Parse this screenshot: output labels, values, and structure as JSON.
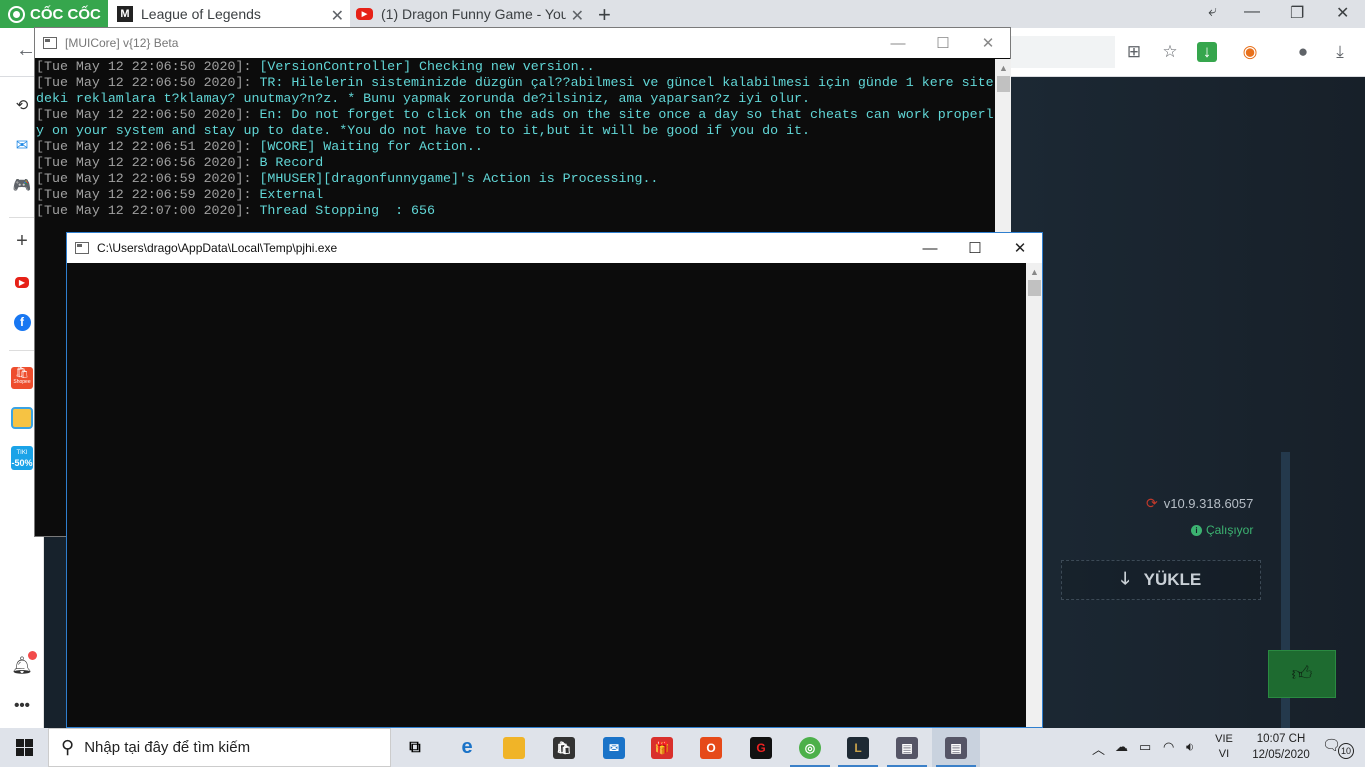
{
  "browser": {
    "logo_text": "CỐC CỐC",
    "tabs": [
      {
        "title": "League of Legends",
        "favicon": "M"
      },
      {
        "title": "(1) Dragon Funny Game - You",
        "favicon": "youtube-icon"
      }
    ],
    "new_tab_symbol": "+",
    "window_controls": [
      "restore-icon",
      "minimize-icon",
      "maximize-icon",
      "close-icon"
    ]
  },
  "sidebar": {
    "items": [
      "history-icon",
      "messenger-icon",
      "game-icon",
      "add-icon",
      "youtube-icon",
      "facebook-icon",
      "shopee-icon",
      "game-app-icon",
      "tiki-icon",
      "bell-icon",
      "more-icon"
    ],
    "tiki_label": "TIKI",
    "tiki_badge": "-50%",
    "shopee_label": "Shopee"
  },
  "page": {
    "version": "v10.9.318.6057",
    "status": "Çalışıyor",
    "install_button": "YÜKLE"
  },
  "console_window_1": {
    "title": "[MUICore] v{12} Beta",
    "lines": [
      {
        "ts": "[Tue May 12 22:06:50 2020]: ",
        "msg": "[VersionController] Checking new version.."
      },
      {
        "ts": "[Tue May 12 22:06:50 2020]: ",
        "msg": "TR: Hilelerin sisteminizde düzgün çal??abilmesi ve güncel kalabilmesi için günde 1 kere sitedeki reklamlara t?klamay? unutmay?n?z. * Bunu yapmak zorunda de?ilsiniz, ama yaparsan?z iyi olur."
      },
      {
        "ts": "[Tue May 12 22:06:50 2020]: ",
        "msg": "En: Do not forget to click on the ads on the site once a day so that cheats can work properly on your system and stay up to date. *You do not have to to it,but it will be good if you do it."
      },
      {
        "ts": "[Tue May 12 22:06:51 2020]: ",
        "msg": "[WCORE] Waiting for Action.."
      },
      {
        "ts": "[Tue May 12 22:06:56 2020]: ",
        "msg": "B Record"
      },
      {
        "ts": "[Tue May 12 22:06:59 2020]: ",
        "msg": "[MHUSER][dragonfunnygame]'s Action is Processing.."
      },
      {
        "ts": "[Tue May 12 22:06:59 2020]: ",
        "msg": "External"
      },
      {
        "ts": "[Tue May 12 22:07:00 2020]: ",
        "msg": "Thread Stopping  : 656"
      }
    ]
  },
  "console_window_2": {
    "title": "C:\\Users\\drago\\AppData\\Local\\Temp\\pjhi.exe"
  },
  "taskbar": {
    "search_placeholder": "Nhập tại đây để tìm kiếm",
    "apps": [
      "task-view-icon",
      "edge-icon",
      "file-explorer-icon",
      "store-icon",
      "mail-icon",
      "gift-icon",
      "office-icon",
      "garena-icon",
      "coccoc-icon",
      "league-icon",
      "console-icon",
      "console-icon"
    ],
    "lang_top": "VIE",
    "lang_bottom": "VI",
    "time": "10:07 CH",
    "date": "12/05/2020",
    "notification_count": "10"
  },
  "colors": {
    "console_text": "#61d6d6",
    "timestamp_text": "#a0a0a0",
    "console_bg": "#0c0c0c",
    "coccoc_green": "#36a64d",
    "status_green": "#3cb371"
  }
}
